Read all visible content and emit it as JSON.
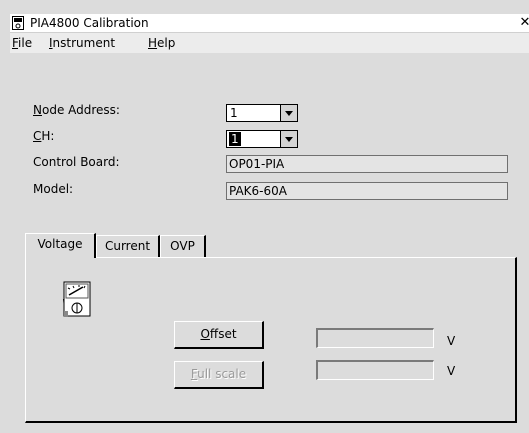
{
  "window": {
    "title": "PIA4800 Calibration",
    "close_glyph": "✕",
    "icon": "app-icon"
  },
  "menu": [
    {
      "label_first": "F",
      "label_rest": "ile"
    },
    {
      "label_first": "I",
      "label_rest": "nstrument"
    },
    {
      "label_first": "H",
      "label_rest": "elp"
    }
  ],
  "form": {
    "node_address": {
      "label_first": "N",
      "label_rest": "ode Address:",
      "value": "1"
    },
    "ch": {
      "label_first": "C",
      "label_rest": "H:",
      "value": "1"
    },
    "control_board": {
      "label": "Control Board:",
      "value": "OP01-PIA"
    },
    "model": {
      "label": "Model:",
      "value": "PAK6-60A"
    }
  },
  "tabs": [
    {
      "label": "Voltage",
      "active": true
    },
    {
      "label": "Current",
      "active": false
    },
    {
      "label": "OVP",
      "active": false
    }
  ],
  "voltage_panel": {
    "icon": "voltmeter-icon",
    "offset_button": {
      "label_first": "O",
      "label_rest": "ffset",
      "enabled": true
    },
    "fullscale_button": {
      "label_first": "F",
      "label_rest": "ull scale",
      "enabled": false
    },
    "offset_value": "",
    "offset_unit": "V",
    "fullscale_value": "",
    "fullscale_unit": "V"
  }
}
